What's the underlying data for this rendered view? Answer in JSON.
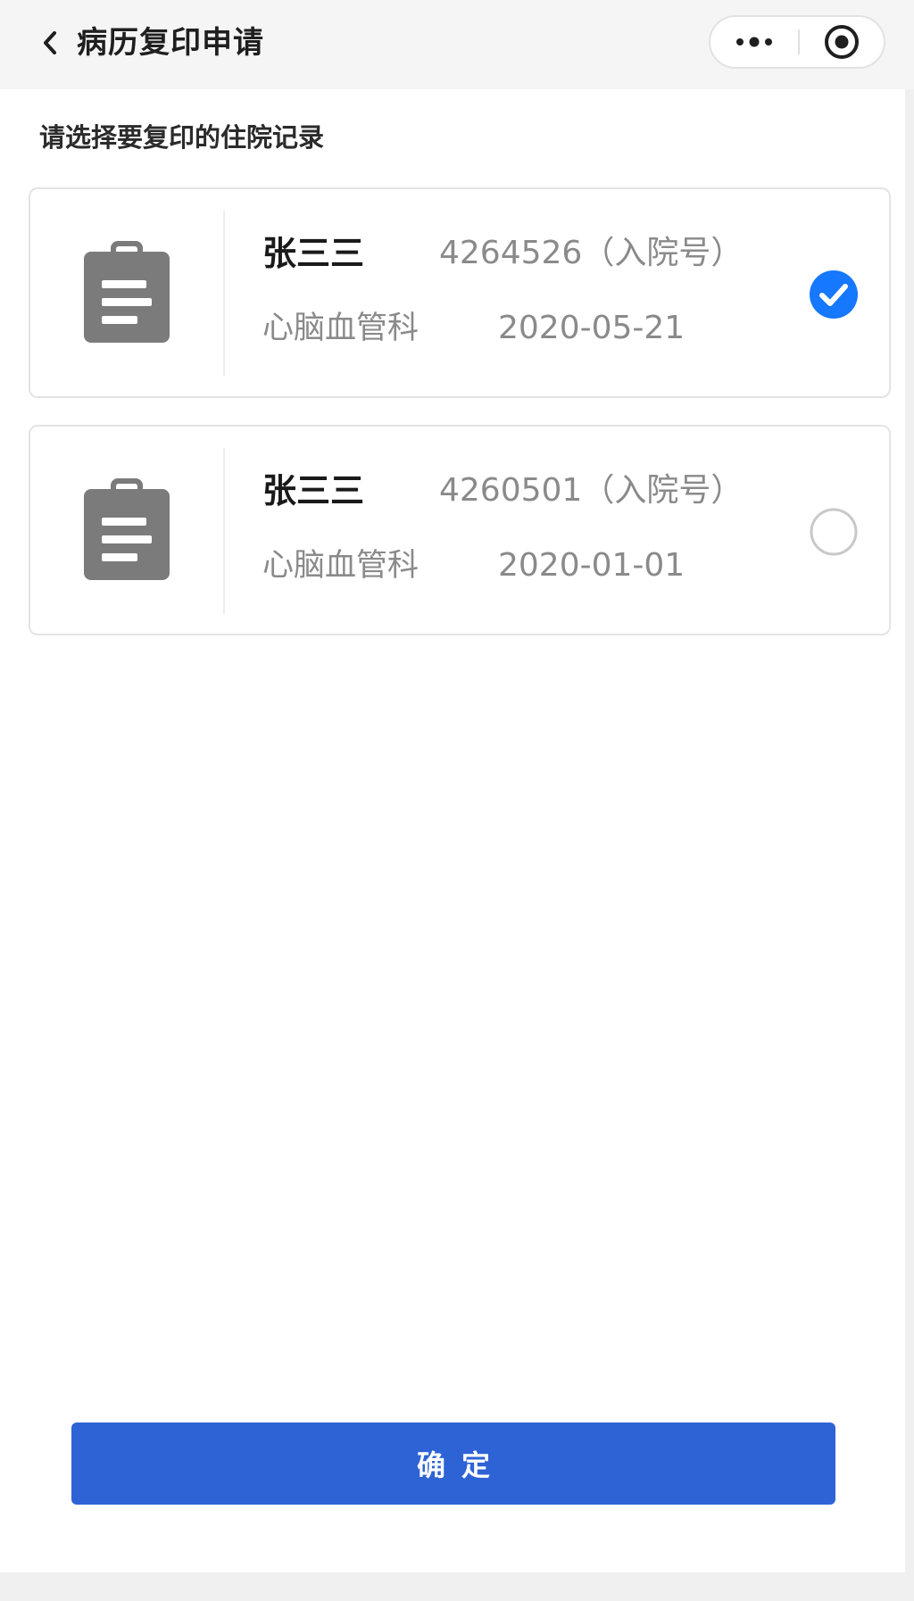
{
  "nav": {
    "title": "病历复印申请",
    "back_icon": "chevron-left-icon",
    "more_icon": "more-dots-icon",
    "close_icon": "target-circle-icon"
  },
  "section": {
    "label": "请选择要复印的住院记录"
  },
  "records": [
    {
      "name": "张三三",
      "admission": "4264526（入院号）",
      "department": "心脑血管科",
      "date": "2020-05-21",
      "selected": true,
      "icon": "clipboard-icon"
    },
    {
      "name": "张三三",
      "admission": "4260501（入院号）",
      "department": "心脑血管科",
      "date": "2020-01-01",
      "selected": false,
      "icon": "clipboard-icon"
    }
  ],
  "confirm": {
    "label": "确定"
  },
  "colors": {
    "accent": "#2e63d6",
    "checked": "#1677ff",
    "icon": "#7b7b7b"
  }
}
